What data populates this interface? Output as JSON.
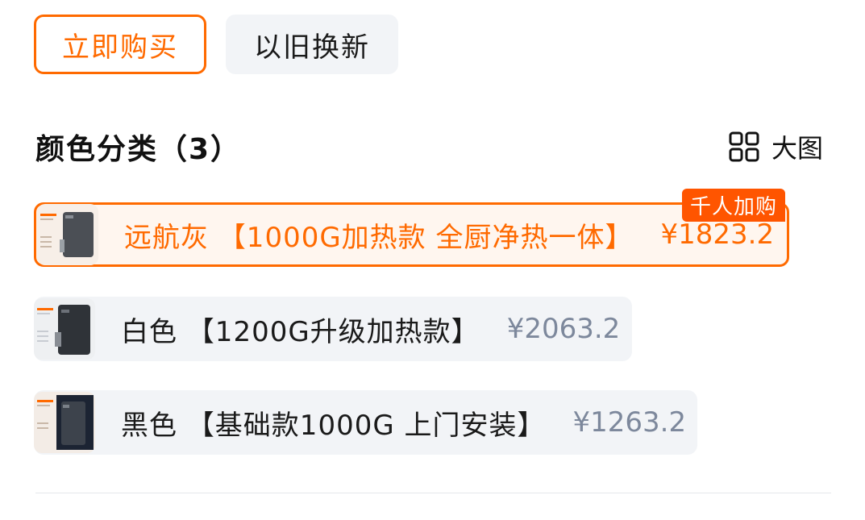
{
  "purchase_modes": {
    "buy_now": "立即购买",
    "trade_in": "以旧换新"
  },
  "section": {
    "title": "颜色分类（3）",
    "view_toggle_label": "大图"
  },
  "variants": [
    {
      "name": "远航灰 【1000G加热款 全厨净热一体】",
      "price": "¥1823.2",
      "badge": "千人加购",
      "selected": true
    },
    {
      "name": "白色 【1200G升级加热款】",
      "price": "¥2063.2",
      "selected": false
    },
    {
      "name": "黑色 【基础款1000G 上门安装】",
      "price": "¥1263.2",
      "selected": false
    }
  ],
  "colors": {
    "accent": "#ff6a00",
    "badge": "#ff5500",
    "option_bg": "#f2f4f7",
    "price_muted": "#7d889c"
  }
}
